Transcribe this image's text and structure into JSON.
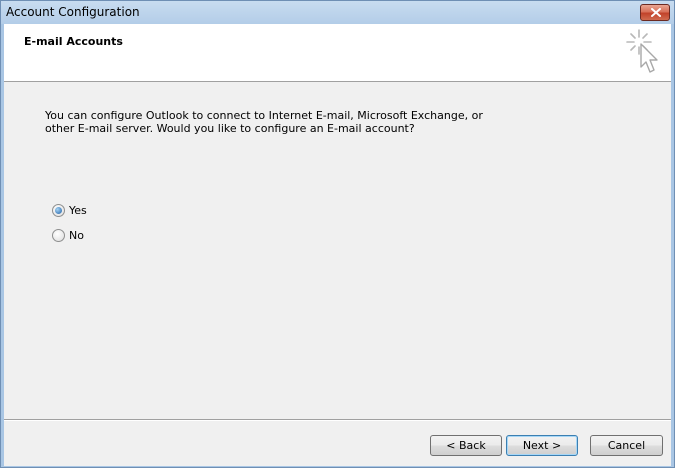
{
  "window": {
    "title": "Account Configuration",
    "close_icon": "close-icon"
  },
  "header": {
    "title": "E-mail Accounts",
    "icon": "wizard-cursor-icon"
  },
  "content": {
    "prompt": "You can configure Outlook to connect to Internet E-mail, Microsoft Exchange, or other E-mail server. Would you like to configure an E-mail account?",
    "options": [
      {
        "label": "Yes",
        "checked": true
      },
      {
        "label": "No",
        "checked": false
      }
    ]
  },
  "buttons": {
    "back": "< Back",
    "next": "Next >",
    "cancel": "Cancel"
  },
  "colors": {
    "titlebar": "#b9d1ea",
    "client_bg": "#f0f0f0",
    "close_button": "#c7472e",
    "default_button_border": "#3c7fb1"
  }
}
